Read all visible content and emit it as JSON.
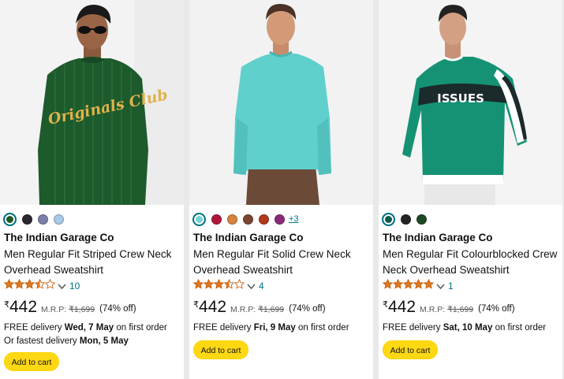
{
  "products": [
    {
      "brand": "The Indian Garage Co",
      "title_line1": "Men Regular Fit Striped Crew Neck",
      "title_line2": "Overhead Sweatshirt",
      "rating_value": 3.5,
      "rating_count": "10",
      "currency": "₹",
      "price": "442",
      "mrp_label": "M.R.P:",
      "mrp_value": "₹1,699",
      "discount": "(74% off)",
      "delivery_prefix": "FREE delivery",
      "delivery_date": "Wed, 7 May",
      "delivery_suffix": "on first order",
      "fastest_prefix": "Or fastest delivery",
      "fastest_date": "Mon, 5 May",
      "button_label": "Add to cart",
      "swatches": [
        "#1f5a2b",
        "#2b2630",
        "#7b7fa8",
        "#a9c9e8"
      ],
      "more_colors": ""
    },
    {
      "brand": "The Indian Garage Co",
      "title_line1": "Men Regular Fit Solid Crew Neck",
      "title_line2": "Overhead Sweatshirt",
      "rating_value": 3.5,
      "rating_count": "4",
      "currency": "₹",
      "price": "442",
      "mrp_label": "M.R.P:",
      "mrp_value": "₹1,699",
      "discount": "(74% off)",
      "delivery_prefix": "FREE delivery",
      "delivery_date": "Fri, 9 May",
      "delivery_suffix": "on first order",
      "button_label": "Add to cart",
      "swatches": [
        "#76d3d6",
        "#b0163b",
        "#d4843f",
        "#7a4532",
        "#b03a1c",
        "#8a2a77"
      ],
      "more_colors": "+3"
    },
    {
      "brand": "The Indian Garage Co",
      "title_line1": "Men Regular Fit Colourblocked Crew",
      "title_line2": "Neck Overhead Sweatshirt",
      "rating_value": 5,
      "rating_count": "1",
      "currency": "₹",
      "price": "442",
      "mrp_label": "M.R.P:",
      "mrp_value": "₹1,699",
      "discount": "(74% off)",
      "delivery_prefix": "FREE delivery",
      "delivery_date": "Sat, 10 May",
      "delivery_suffix": "on first order",
      "button_label": "Add to cart",
      "swatches": [
        "#0f5a4f",
        "#232323",
        "#1d4a25"
      ],
      "more_colors": ""
    }
  ],
  "images": [
    {
      "icon": "model-green-striped-sweatshirt",
      "sweatshirt_color": "#1d5a2c",
      "print_text": "Originals Club"
    },
    {
      "icon": "model-aqua-sweatshirt",
      "sweatshirt_color": "#5fd0cc"
    },
    {
      "icon": "model-green-colourblocked-sweatshirt",
      "sweatshirt_color": "#159273",
      "print_text": "ISSUES"
    }
  ],
  "colors": {
    "link": "#007185",
    "star": "#de7921",
    "button": "#ffd814"
  }
}
